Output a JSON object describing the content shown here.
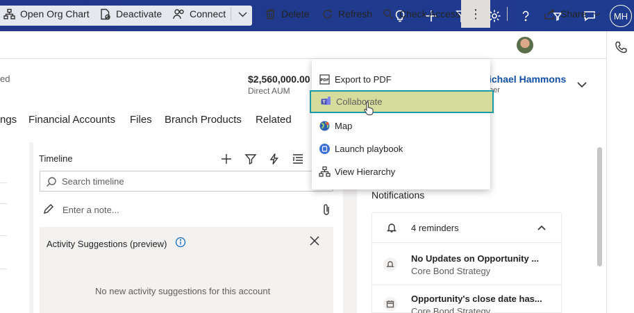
{
  "topbar": {
    "icons": [
      "lightbulb-icon",
      "plus-icon",
      "filter-icon",
      "gear-icon",
      "help-icon",
      "assistant-filter-icon",
      "chat-icon"
    ],
    "avatar_initials": "MH"
  },
  "command_bar": {
    "items": [
      {
        "label": "Open Org Chart",
        "icon": "org-chart-icon"
      },
      {
        "label": "Deactivate",
        "icon": "deactivate-icon"
      },
      {
        "label": "Connect",
        "icon": "connect-icon"
      },
      {
        "label": "Delete",
        "icon": "trash-icon"
      },
      {
        "label": "Refresh",
        "icon": "refresh-icon"
      },
      {
        "label": "Check Access",
        "icon": "check-access-icon"
      }
    ],
    "more_label": "⋮",
    "share_label": "Share"
  },
  "header": {
    "left_text": "ed",
    "aum_value": "$2,560,000.00",
    "aum_label": "Direct AUM",
    "owner_name": "ichael Hammons",
    "owner_label": "ner"
  },
  "tabs": [
    "ngs",
    "Financial Accounts",
    "Files",
    "Branch Products",
    "Related"
  ],
  "timeline": {
    "title": "Timeline",
    "search_placeholder": "Search timeline",
    "note_placeholder": "Enter a note...",
    "suggestions_title": "Activity Suggestions (preview)",
    "suggestions_empty": "No new activity suggestions for this account"
  },
  "notifications": {
    "title": "Notifications",
    "reminders": "4 reminders",
    "items": [
      {
        "title": "No Updates on Opportunity ...",
        "subtitle": "Core Bond Strategy"
      },
      {
        "title": "Opportunity's close date has...",
        "subtitle": "Core Bond Strategy"
      }
    ]
  },
  "menu": {
    "items": [
      {
        "label": "Export to PDF",
        "icon": "pdf-icon"
      },
      {
        "label": "Collaborate",
        "icon": "teams-icon"
      },
      {
        "label": "Map",
        "icon": "globe-icon"
      },
      {
        "label": "Launch playbook",
        "icon": "playbook-icon"
      },
      {
        "label": "View Hierarchy",
        "icon": "hierarchy-icon"
      }
    ],
    "highlighted": "Collaborate"
  },
  "colors": {
    "topbar": "#1f3a8a",
    "highlight_fill": "#d6dc9c",
    "highlight_border": "#1b9aa5",
    "link": "#0f4fa8"
  }
}
